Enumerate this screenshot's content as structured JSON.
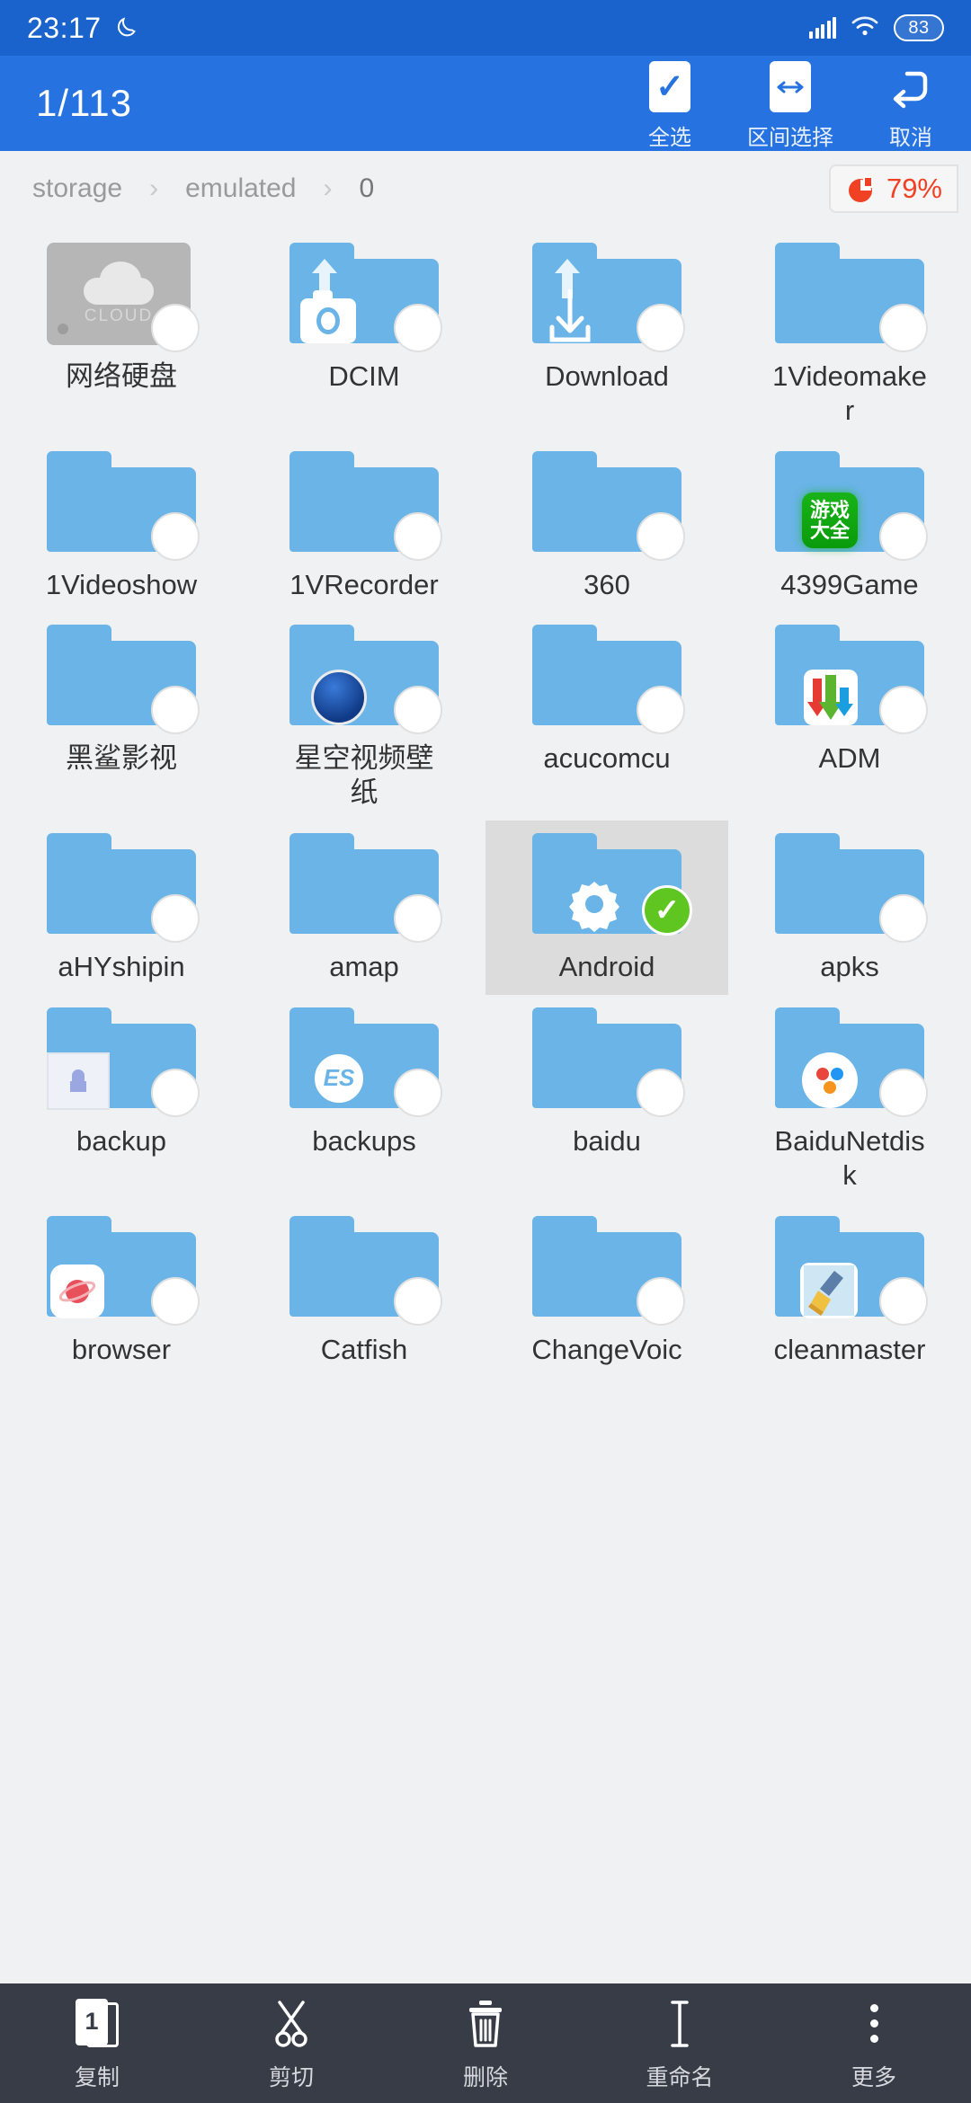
{
  "statusbar": {
    "time": "23:17",
    "moon_icon": "moon-icon",
    "signal_icon": "signal-bars-icon",
    "wifi_icon": "wifi-icon",
    "battery": "83"
  },
  "selection_toolbar": {
    "count": "1/113",
    "actions": [
      {
        "label": "全选",
        "icon": "check-box-icon"
      },
      {
        "label": "区间选择",
        "icon": "range-select-icon"
      },
      {
        "label": "取消",
        "icon": "undo-cancel-icon"
      }
    ]
  },
  "breadcrumb": {
    "items": [
      "storage",
      "emulated",
      "0"
    ],
    "separator": "›",
    "storage_badge": {
      "text": "79%",
      "icon": "pie-chart-icon",
      "color": "#f04124"
    }
  },
  "grid": {
    "items": [
      {
        "name": "网络硬盘",
        "icon": "cloud-drive-icon",
        "selected": false,
        "type": "cloud"
      },
      {
        "name": "DCIM",
        "icon": "camera-folder-icon",
        "selected": false,
        "type": "folder"
      },
      {
        "name": "Download",
        "icon": "download-folder-icon",
        "selected": false,
        "type": "folder"
      },
      {
        "name": "1Videomaker",
        "icon": "folder-icon",
        "selected": false,
        "type": "folder"
      },
      {
        "name": "1Videoshow",
        "icon": "folder-icon",
        "selected": false,
        "type": "folder"
      },
      {
        "name": "1VRecorder",
        "icon": "folder-icon",
        "selected": false,
        "type": "folder"
      },
      {
        "name": "360",
        "icon": "folder-icon",
        "selected": false,
        "type": "folder"
      },
      {
        "name": "4399Game",
        "icon": "game-badge-folder-icon",
        "selected": false,
        "type": "folder",
        "badge_text": "游戏\n大全"
      },
      {
        "name": "黑鲨影视",
        "icon": "folder-icon",
        "selected": false,
        "type": "folder"
      },
      {
        "name": "星空视频壁纸",
        "icon": "starry-badge-folder-icon",
        "selected": false,
        "type": "folder"
      },
      {
        "name": "acucomcu",
        "icon": "folder-icon",
        "selected": false,
        "type": "folder"
      },
      {
        "name": "ADM",
        "icon": "adm-badge-folder-icon",
        "selected": false,
        "type": "folder"
      },
      {
        "name": "aHYshipin",
        "icon": "folder-icon",
        "selected": false,
        "type": "folder"
      },
      {
        "name": "amap",
        "icon": "folder-icon",
        "selected": false,
        "type": "folder"
      },
      {
        "name": "Android",
        "icon": "gear-folder-icon",
        "selected": true,
        "type": "folder"
      },
      {
        "name": "apks",
        "icon": "folder-icon",
        "selected": false,
        "type": "folder"
      },
      {
        "name": "backup",
        "icon": "backup-badge-folder-icon",
        "selected": false,
        "type": "folder"
      },
      {
        "name": "backups",
        "icon": "es-badge-folder-icon",
        "selected": false,
        "type": "folder",
        "badge_text": "ES"
      },
      {
        "name": "baidu",
        "icon": "folder-icon",
        "selected": false,
        "type": "folder"
      },
      {
        "name": "BaiduNetdisk",
        "icon": "baidu-netdisk-badge-folder-icon",
        "selected": false,
        "type": "folder"
      },
      {
        "name": "browser",
        "icon": "browser-badge-folder-icon",
        "selected": false,
        "type": "folder"
      },
      {
        "name": "Catfish",
        "icon": "folder-icon",
        "selected": false,
        "type": "folder"
      },
      {
        "name": "ChangeVoic",
        "icon": "folder-icon",
        "selected": false,
        "type": "folder"
      },
      {
        "name": "cleanmaster",
        "icon": "cleanmaster-badge-folder-icon",
        "selected": false,
        "type": "folder"
      }
    ]
  },
  "bottom_bar": {
    "items": [
      {
        "label": "复制",
        "icon": "copy-icon",
        "badge": "1"
      },
      {
        "label": "剪切",
        "icon": "scissors-cut-icon"
      },
      {
        "label": "删除",
        "icon": "trash-delete-icon"
      },
      {
        "label": "重命名",
        "icon": "rename-text-cursor-icon"
      },
      {
        "label": "更多",
        "icon": "more-vertical-dots-icon"
      }
    ]
  }
}
